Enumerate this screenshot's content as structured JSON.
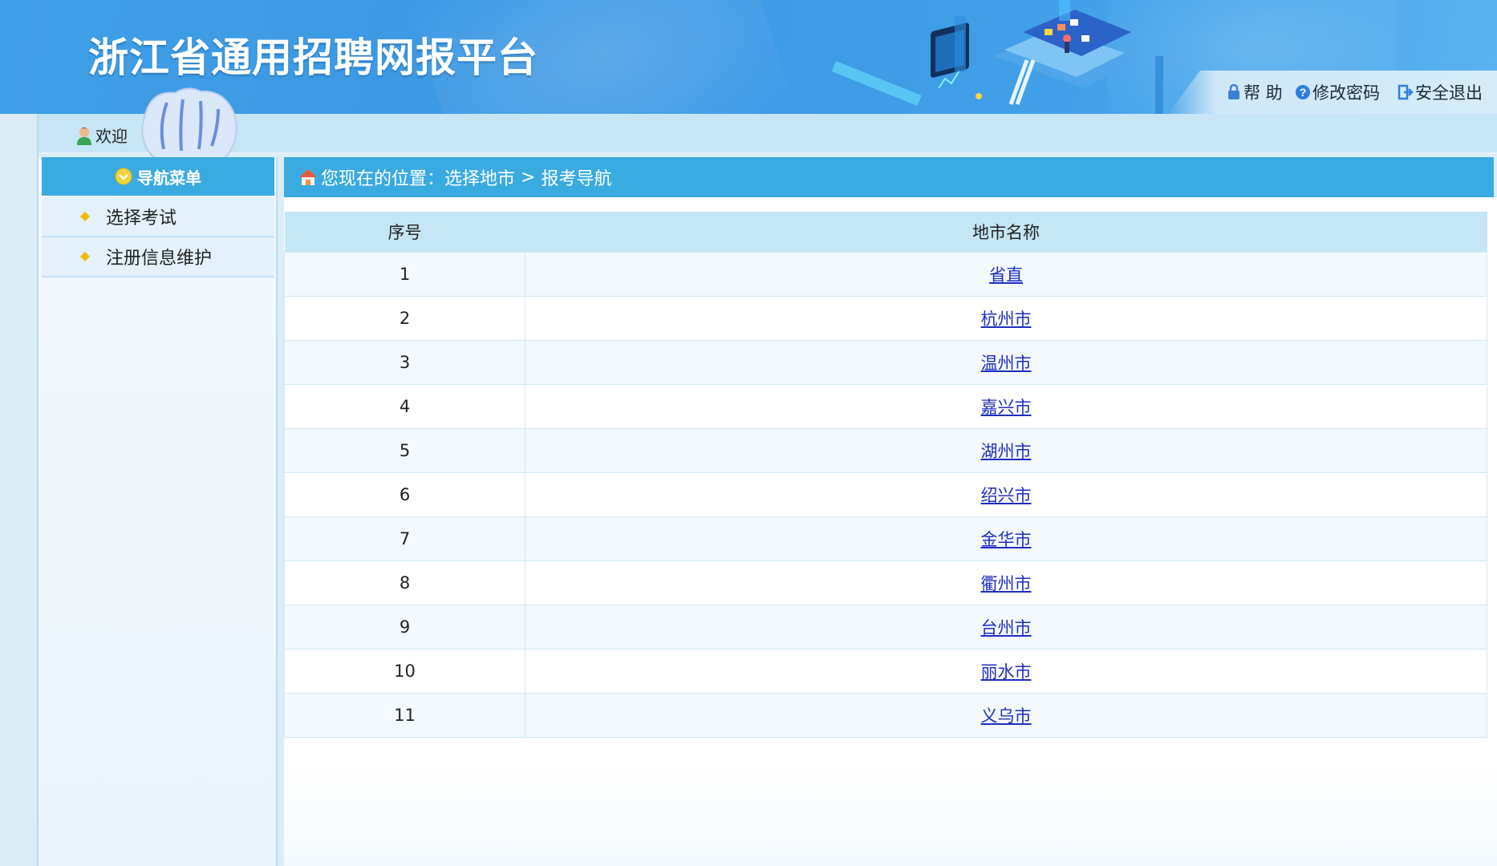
{
  "header": {
    "title": "浙江省通用招聘网报平台",
    "links": [
      {
        "label": "帮 助",
        "icon": "help-lock-icon"
      },
      {
        "label": "修改密码",
        "icon": "question-icon"
      },
      {
        "label": "安全退出",
        "icon": "exit-icon"
      }
    ]
  },
  "welcome": {
    "text": "欢迎"
  },
  "sidebar": {
    "title": "导航菜单",
    "items": [
      {
        "label": "选择考试"
      },
      {
        "label": "注册信息维护"
      }
    ]
  },
  "breadcrumb": {
    "prefix": "您现在的位置：",
    "path1": "选择地市",
    "separator": " > ",
    "path2": "报考导航"
  },
  "table": {
    "headers": [
      "序号",
      "地市名称"
    ],
    "rows": [
      {
        "index": "1",
        "city": "省直"
      },
      {
        "index": "2",
        "city": "杭州市"
      },
      {
        "index": "3",
        "city": "温州市"
      },
      {
        "index": "4",
        "city": "嘉兴市"
      },
      {
        "index": "5",
        "city": "湖州市"
      },
      {
        "index": "6",
        "city": "绍兴市"
      },
      {
        "index": "7",
        "city": "金华市"
      },
      {
        "index": "8",
        "city": "衢州市"
      },
      {
        "index": "9",
        "city": "台州市"
      },
      {
        "index": "10",
        "city": "丽水市"
      },
      {
        "index": "11",
        "city": "义乌市"
      }
    ]
  },
  "colors": {
    "header_blue": "#3f9fe6",
    "menu_blue": "#3aabe0",
    "table_header": "#c5e6f4",
    "link": "#1d2fbd"
  }
}
